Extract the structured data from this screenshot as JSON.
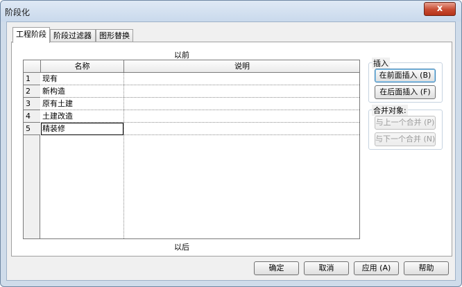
{
  "window": {
    "title": "阶段化",
    "close_label": "x"
  },
  "tabs": [
    {
      "label": "工程阶段",
      "active": true
    },
    {
      "label": "阶段过滤器",
      "active": false
    },
    {
      "label": "图形替换",
      "active": false
    }
  ],
  "grid": {
    "caption_top": "以前",
    "caption_bottom": "以后",
    "headers": {
      "name": "名称",
      "desc": "说明"
    },
    "rows": [
      {
        "num": "1",
        "name": "现有",
        "desc": ""
      },
      {
        "num": "2",
        "name": "新构造",
        "desc": ""
      },
      {
        "num": "3",
        "name": "原有土建",
        "desc": ""
      },
      {
        "num": "4",
        "name": "土建改造",
        "desc": ""
      },
      {
        "num": "5",
        "name": "精装修",
        "desc": ""
      }
    ]
  },
  "insert_group": {
    "label": "插入",
    "before_label": "在前面插入 (B)",
    "after_label": "在后面插入 (F)"
  },
  "merge_group": {
    "label": "合并对象:",
    "prev_label": "与上一个合并 (P)",
    "next_label": "与下一个合并 (N)"
  },
  "footer": {
    "ok_label": "确定",
    "cancel_label": "取消",
    "apply_label": "应用 (A)",
    "help_label": "帮助"
  }
}
